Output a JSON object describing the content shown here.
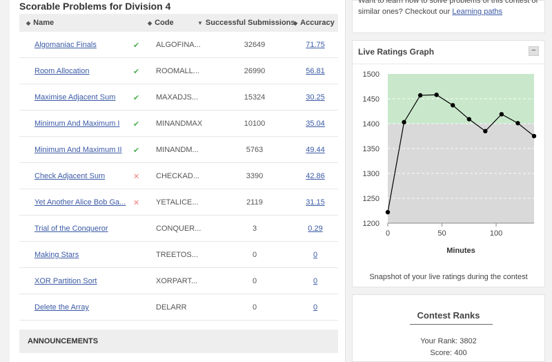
{
  "left": {
    "title": "Scorable Problems for Division 4",
    "headers": {
      "name": "Name",
      "code": "Code",
      "subs": "Successful Submissions",
      "acc": "Accuracy"
    },
    "announcements": "ANNOUNCEMENTS"
  },
  "problems": [
    {
      "name": "Algomaniac Finals",
      "status": "✔",
      "statusType": "ok",
      "code": "ALGOFINA...",
      "subs": "32649",
      "acc": "71.75"
    },
    {
      "name": "Room Allocation",
      "status": "✔",
      "statusType": "ok",
      "code": "ROOMALL...",
      "subs": "26990",
      "acc": "56.81"
    },
    {
      "name": "Maximise Adjacent Sum",
      "status": "✔",
      "statusType": "ok",
      "code": "MAXADJS...",
      "subs": "15324",
      "acc": "30.25"
    },
    {
      "name": "Minimum And Maximum I",
      "status": "✔",
      "statusType": "ok",
      "code": "MINANDMAX",
      "subs": "10100",
      "acc": "35.04"
    },
    {
      "name": "Minimum And Maximum II",
      "status": "✔",
      "statusType": "ok",
      "code": "MINANDM...",
      "subs": "5763",
      "acc": "49.44"
    },
    {
      "name": "Check Adjacent Sum",
      "status": "✕",
      "statusType": "no",
      "code": "CHECKAD...",
      "subs": "3390",
      "acc": "42.86"
    },
    {
      "name": "Yet Another Alice Bob Ga...",
      "status": "✕",
      "statusType": "no",
      "code": "YETALICE...",
      "subs": "2119",
      "acc": "31.15"
    },
    {
      "name": "Trial of the Conqueror",
      "status": "",
      "statusType": "",
      "code": "CONQUER...",
      "subs": "3",
      "acc": "0.29"
    },
    {
      "name": "Making Stars",
      "status": "",
      "statusType": "",
      "code": "TREETOS...",
      "subs": "0",
      "acc": "0"
    },
    {
      "name": "XOR Partition Sort",
      "status": "",
      "statusType": "",
      "code": "XORPART...",
      "subs": "0",
      "acc": "0"
    },
    {
      "name": "Delete the Array",
      "status": "",
      "statusType": "",
      "code": "DELARR",
      "subs": "0",
      "acc": "0"
    }
  ],
  "learn": {
    "line1": "Want to learn how to solve problems of this contest or",
    "line2_prefix": "similar ones? Checkout our ",
    "link": "Learning paths"
  },
  "graph": {
    "title": "Live Ratings Graph",
    "collapse_label": "−",
    "snapshot": "Snapshot of your live ratings during the contest"
  },
  "chart_data": {
    "type": "line",
    "xlabel": "Minutes",
    "ylabel": "",
    "xlim": [
      0,
      135
    ],
    "ylim": [
      1200,
      1500
    ],
    "xticks": [
      0,
      50,
      100
    ],
    "yticks": [
      1200,
      1250,
      1300,
      1350,
      1400,
      1450,
      1500
    ],
    "bands": [
      {
        "from": 1200,
        "to": 1400,
        "color": "#d9d9d9"
      },
      {
        "from": 1400,
        "to": 1500,
        "color": "#c9e8cb"
      }
    ],
    "series": [
      {
        "x": [
          0,
          15,
          30,
          45,
          60,
          75,
          90,
          105,
          120,
          135
        ],
        "y": [
          1222,
          1403,
          1457,
          1458,
          1437,
          1409,
          1385,
          1419,
          1401,
          1375
        ]
      }
    ]
  },
  "ranks": {
    "title": "Contest Ranks",
    "rank_label": "Your Rank: 3802",
    "score_label": "Score: 400"
  }
}
